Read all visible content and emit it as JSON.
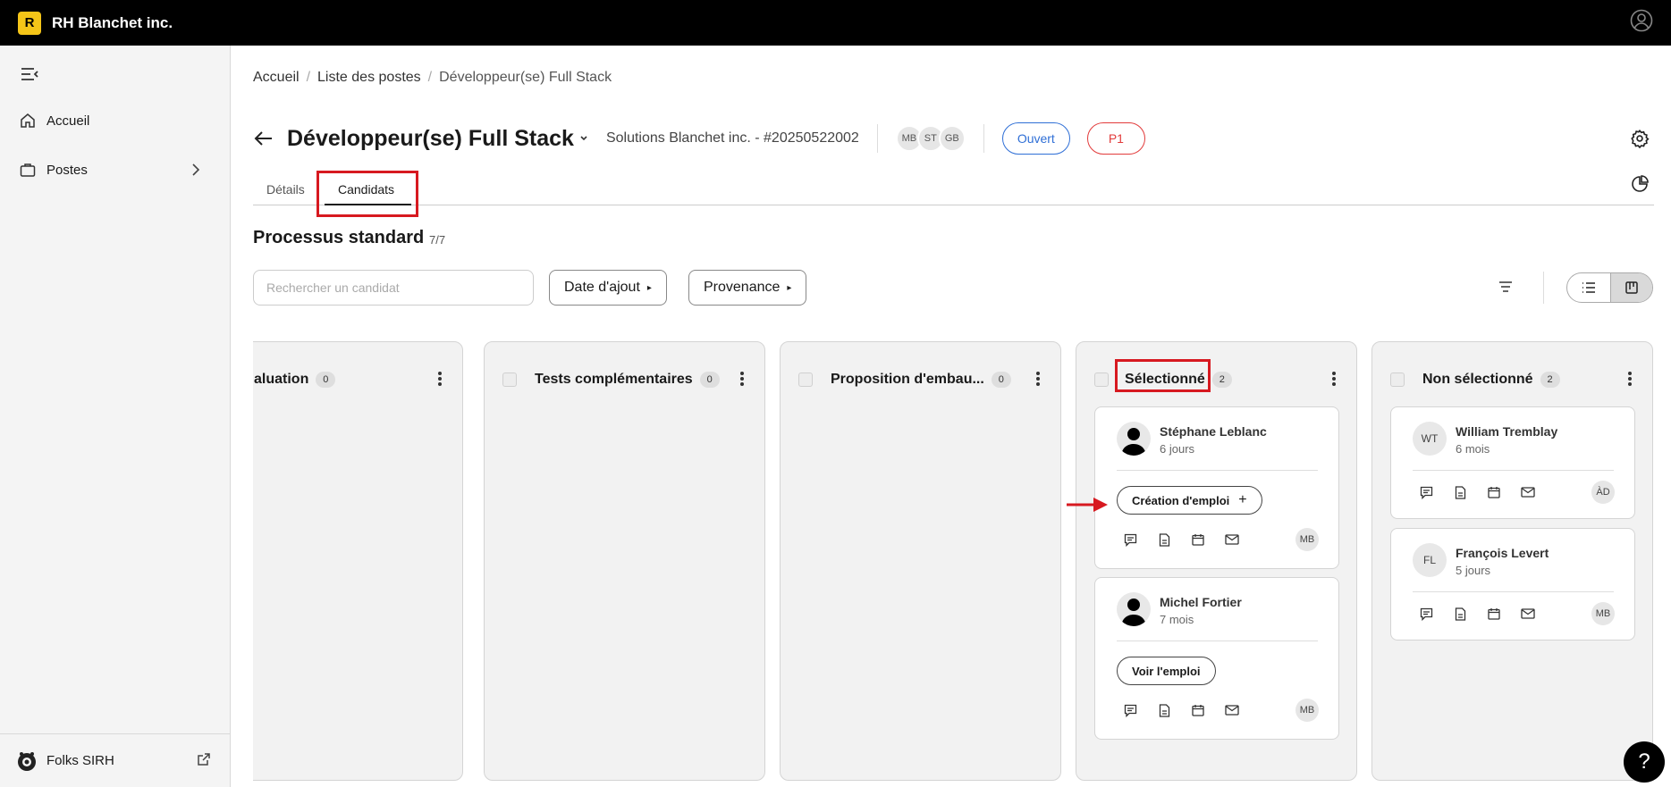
{
  "app": {
    "logo_letter": "R",
    "company": "RH Blanchet inc."
  },
  "sidebar": {
    "items": [
      {
        "label": "Accueil",
        "icon": "home-icon"
      },
      {
        "label": "Postes",
        "icon": "briefcase-icon"
      }
    ],
    "footer_label": "Folks SIRH"
  },
  "breadcrumb": [
    "Accueil",
    "Liste des postes",
    "Développeur(se) Full Stack"
  ],
  "job": {
    "title": "Développeur(se) Full Stack",
    "company_ref": "Solutions Blanchet inc. - #20250522002",
    "assignees": [
      "MB",
      "ST",
      "GB"
    ],
    "status": "Ouvert",
    "priority": "P1",
    "status_color": "#2f6fd6",
    "priority_color": "#e23b3b"
  },
  "tabs": [
    {
      "label": "Détails"
    },
    {
      "label": "Candidats"
    }
  ],
  "process": {
    "title": "Processus standard",
    "count": "7/7"
  },
  "search": {
    "placeholder": "Rechercher un candidat"
  },
  "filters": {
    "date_label": "Date d'ajout",
    "source_label": "Provenance"
  },
  "columns": [
    {
      "title": "aluation",
      "count": "0",
      "cards": []
    },
    {
      "title": "Tests complémentaires",
      "count": "0",
      "cards": []
    },
    {
      "title": "Proposition d'embau...",
      "count": "0",
      "cards": []
    },
    {
      "title": "Sélectionné",
      "count": "2",
      "cards": [
        {
          "name": "Stéphane Leblanc",
          "time": "6 jours",
          "chip": "Création d'emploi",
          "owner": "MB"
        },
        {
          "name": "Michel Fortier",
          "time": "7 mois",
          "chip": "Voir l'emploi",
          "owner": "MB"
        }
      ]
    },
    {
      "title": "Non sélectionné",
      "count": "2",
      "cards": [
        {
          "name": "William Tremblay",
          "time": "6 mois",
          "initials": "WT",
          "owner": "ÀD"
        },
        {
          "name": "François Levert",
          "time": "5 jours",
          "initials": "FL",
          "owner": "MB"
        }
      ]
    }
  ],
  "help": "?",
  "highlight_color": "#d71920"
}
